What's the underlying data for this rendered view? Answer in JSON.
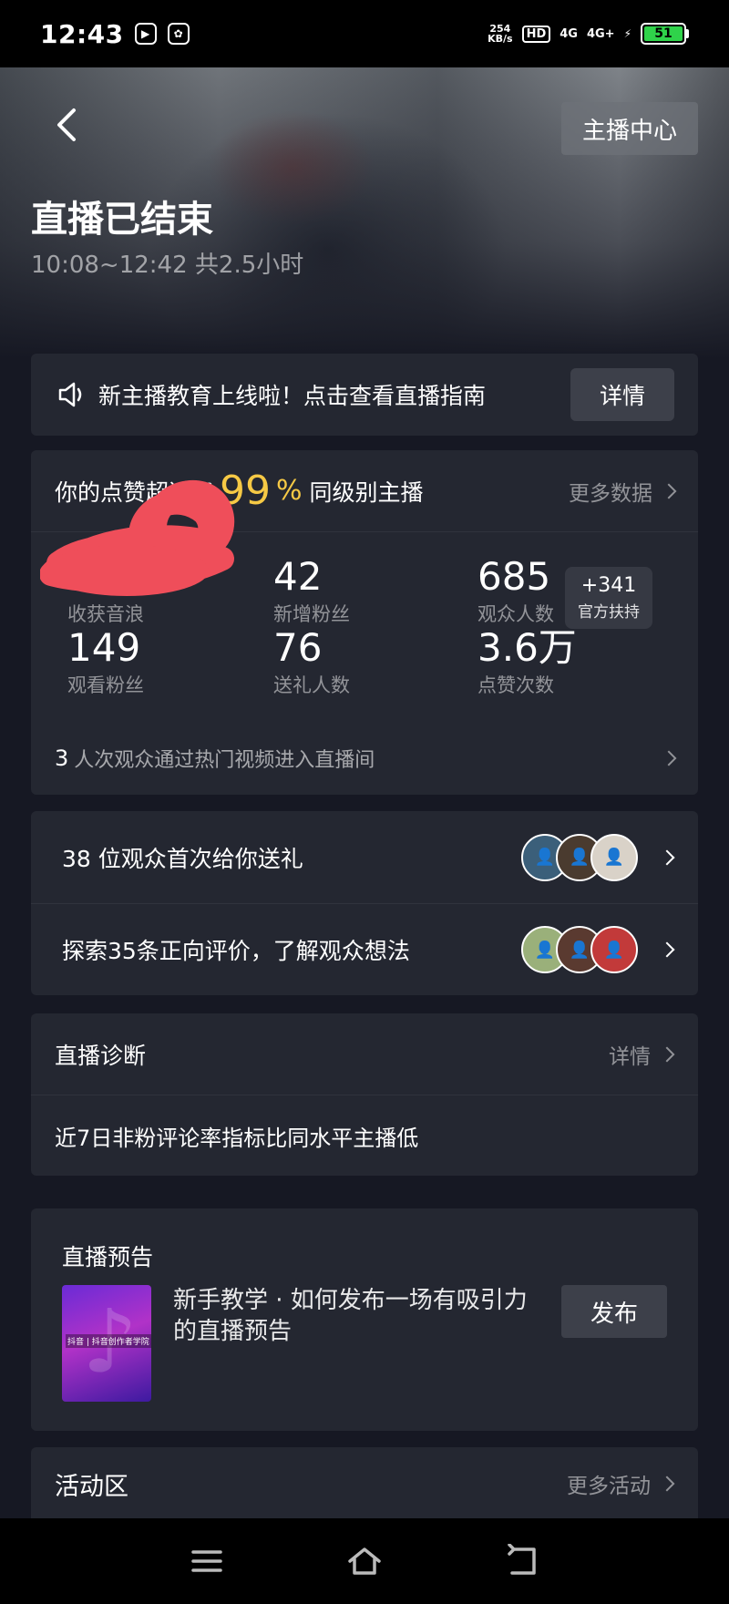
{
  "status_bar": {
    "time": "12:43",
    "net_speed_value": "254",
    "net_speed_unit": "KB/s",
    "hd": "HD",
    "sig1": "4G",
    "sig2": "4G+",
    "battery": "51",
    "battery_color": "#2fd34a"
  },
  "header": {
    "anchor_center": "主播中心",
    "title": "直播已结束",
    "time_range": "10:08~12:42 共2.5小时"
  },
  "notice": {
    "text": "新主播教育上线啦！点击查看直播指南",
    "button": "详情"
  },
  "stats": {
    "header_prefix": "你的点赞超过了",
    "percent": "99",
    "percent_symbol": "%",
    "header_suffix": "同级别主播",
    "more": "更多数据",
    "items": [
      {
        "value": "2",
        "label": "收获音浪"
      },
      {
        "value": "42",
        "label": "新增粉丝"
      },
      {
        "value": "685",
        "label": "观众人数"
      },
      {
        "value": "149",
        "label": "观看粉丝"
      },
      {
        "value": "76",
        "label": "送礼人数"
      },
      {
        "value": "3.6万",
        "label": "点赞次数"
      }
    ],
    "support_value": "+341",
    "support_label": "官方扶持",
    "hot_count": "3",
    "hot_text": "人次观众通过热门视频进入直播间",
    "accent_color": "#f6c945"
  },
  "gifts": {
    "rows": [
      {
        "text": "38 位观众首次给你送礼"
      },
      {
        "text": "探索35条正向评价，了解观众想法"
      }
    ]
  },
  "diagnosis": {
    "title": "直播诊断",
    "detail": "详情",
    "body": "近7日非粉评论率指标比同水平主播低"
  },
  "preview": {
    "title": "直播预告",
    "thumb_label": "抖音 | 抖音创作者学院",
    "text": "新手教学 · 如何发布一场有吸引力的直播预告",
    "button": "发布"
  },
  "activity": {
    "title": "活动区",
    "more": "更多活动"
  }
}
